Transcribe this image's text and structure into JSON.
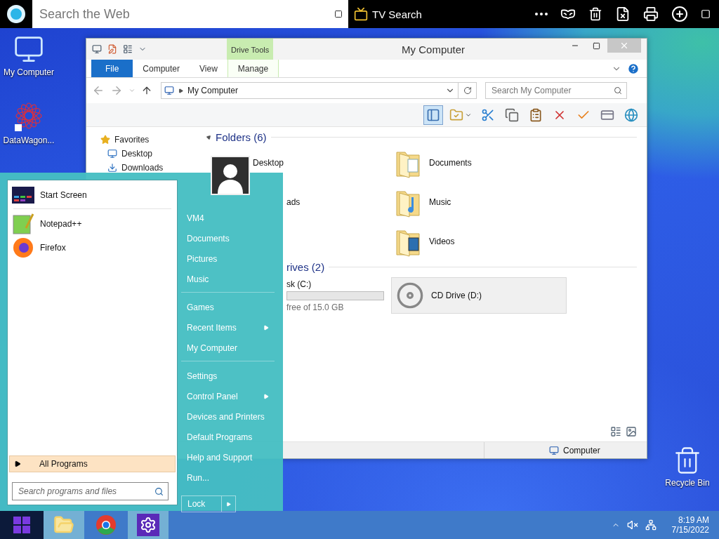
{
  "top_bar": {
    "search": {
      "placeholder": "Search the Web"
    },
    "tv_search": "TV Search"
  },
  "desktop_icons": [
    {
      "label": "My Computer",
      "kind": "computer"
    },
    {
      "label": "DataWagon...",
      "kind": "datawagon"
    },
    {
      "label": "Recycle Bin",
      "kind": "recycle"
    }
  ],
  "explorer": {
    "title": "My Computer",
    "context_tab": "Drive Tools",
    "ribbon_tabs": [
      {
        "label": "File",
        "kind": "file"
      },
      {
        "label": "Computer",
        "kind": "tab"
      },
      {
        "label": "View",
        "kind": "tab"
      },
      {
        "label": "Manage",
        "kind": "context"
      }
    ],
    "address": "My Computer",
    "search": {
      "placeholder": "Search My Computer"
    },
    "toolbar": [
      {
        "kind": "preview",
        "selected": true
      },
      {
        "kind": "folder-options",
        "selected": false
      },
      {
        "kind": "cut",
        "selected": false
      },
      {
        "kind": "copy",
        "selected": false
      },
      {
        "kind": "paste",
        "selected": false
      },
      {
        "kind": "delete",
        "selected": false
      },
      {
        "kind": "check",
        "selected": false
      },
      {
        "kind": "rename",
        "selected": false
      },
      {
        "kind": "globe",
        "selected": false
      }
    ],
    "nav": [
      {
        "label": "Favorites",
        "kind": "star",
        "children": [
          {
            "label": "Desktop",
            "kind": "desktop"
          },
          {
            "label": "Downloads",
            "kind": "download"
          }
        ]
      }
    ],
    "folders": {
      "heading": "Folders (6)",
      "column_1": [
        {
          "label": "Desktop",
          "kind": "full"
        },
        {
          "label": "ads",
          "kind": "partial"
        }
      ],
      "column_2": [
        {
          "label": "Documents",
          "kind": "documents"
        },
        {
          "label": "Music",
          "kind": "music"
        },
        {
          "label": "Videos",
          "kind": "videos"
        }
      ]
    },
    "drives": {
      "heading": "rives (2)",
      "items": [
        {
          "label": "sk (C:)",
          "detail": "free of 15.0 GB",
          "kind": "disk",
          "selected": false
        },
        {
          "label": "CD Drive (D:)",
          "kind": "cd",
          "selected": true
        }
      ]
    },
    "status": "Computer"
  },
  "start_menu": {
    "pinned": [
      {
        "label": "Start Screen",
        "kind": "start-screen"
      }
    ],
    "recent": [
      {
        "label": "Notepad++",
        "kind": "notepad"
      },
      {
        "label": "Firefox",
        "kind": "firefox"
      }
    ],
    "all_programs": "All Programs",
    "search": {
      "placeholder": "Search programs and files"
    },
    "places": [
      {
        "items": [
          {
            "label": "VM4",
            "submenu": false
          },
          {
            "label": "Documents",
            "submenu": false
          },
          {
            "label": "Pictures",
            "submenu": false
          },
          {
            "label": "Music",
            "submenu": false
          }
        ]
      },
      {
        "items": [
          {
            "label": "Games",
            "submenu": false
          },
          {
            "label": "Recent Items",
            "submenu": true
          },
          {
            "label": "My Computer",
            "submenu": false
          }
        ]
      },
      {
        "items": [
          {
            "label": "Settings",
            "submenu": false
          },
          {
            "label": "Control Panel",
            "submenu": true
          },
          {
            "label": "Devices and Printers",
            "submenu": false
          },
          {
            "label": "Default Programs",
            "submenu": false
          },
          {
            "label": "Help and Support",
            "submenu": false
          },
          {
            "label": "Run...",
            "submenu": false
          }
        ]
      }
    ],
    "lock": "Lock"
  },
  "taskbar": {
    "apps": [
      {
        "kind": "explorer",
        "running": true
      },
      {
        "kind": "chrome",
        "running": false
      },
      {
        "kind": "settings",
        "running": true
      }
    ],
    "time": "8:19 AM",
    "date": "7/15/2022"
  }
}
